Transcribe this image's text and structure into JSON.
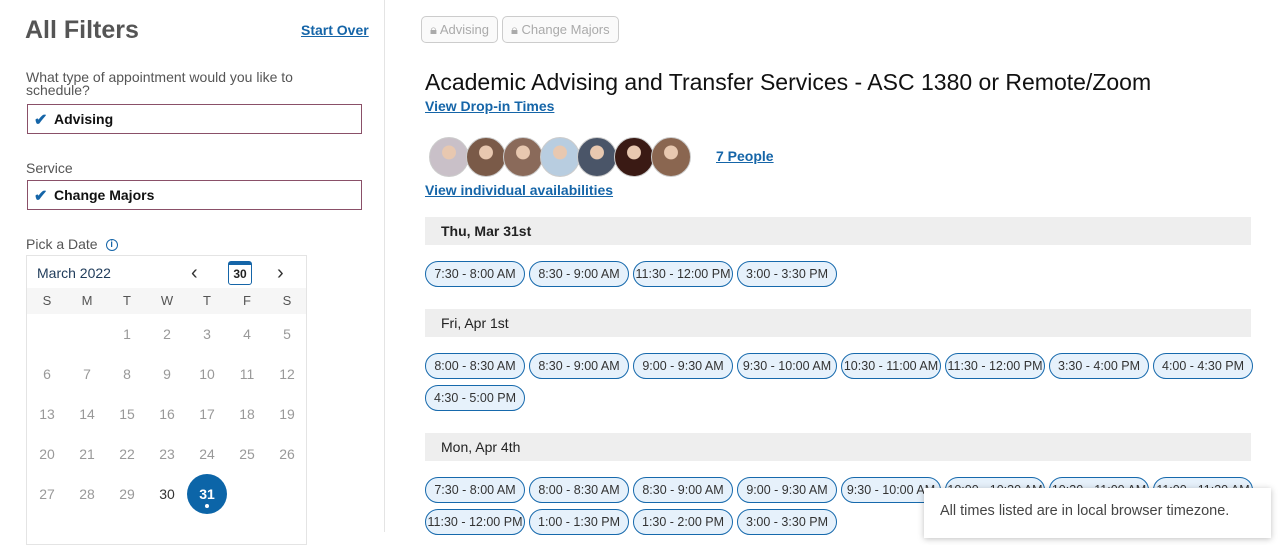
{
  "sidebar": {
    "title": "All Filters",
    "start_over": "Start Over",
    "appt_question": "What type of appointment would you like to schedule?",
    "appt_value": "Advising",
    "service_label": "Service",
    "service_value": "Change Majors",
    "date_label": "Pick a Date"
  },
  "calendar": {
    "month": "March 2022",
    "today": "30",
    "weekdays": [
      "S",
      "M",
      "T",
      "W",
      "T",
      "F",
      "S"
    ],
    "days": [
      "",
      "",
      "1",
      "2",
      "3",
      "4",
      "5",
      "6",
      "7",
      "8",
      "9",
      "10",
      "11",
      "12",
      "13",
      "14",
      "15",
      "16",
      "17",
      "18",
      "19",
      "20",
      "21",
      "22",
      "23",
      "24",
      "25",
      "26",
      "27",
      "28",
      "29",
      "30",
      "31",
      "",
      ""
    ],
    "available": [
      "30",
      "31"
    ],
    "selected": "31"
  },
  "chips": [
    "Advising",
    "Change Majors"
  ],
  "main": {
    "title": "Academic Advising and Transfer Services - ASC 1380 or Remote/Zoom",
    "drop_in": "View Drop-in Times",
    "people": "7 People",
    "individual": "View individual availabilities"
  },
  "avatar_colors": [
    "#c9c0c8",
    "#7a5a48",
    "#8a6a5a",
    "#b8cde0",
    "#4a5568",
    "#3a1a14",
    "#8a6650"
  ],
  "days": [
    {
      "label": "Thu, Mar 31st",
      "slots": [
        "7:30 - 8:00 AM",
        "8:30 - 9:00 AM",
        "11:30 - 12:00 PM",
        "3:00 - 3:30 PM"
      ]
    },
    {
      "label": "Fri, Apr 1st",
      "slots": [
        "8:00 - 8:30 AM",
        "8:30 - 9:00 AM",
        "9:00 - 9:30 AM",
        "9:30 - 10:00 AM",
        "10:30 - 11:00 AM",
        "11:30 - 12:00 PM",
        "3:30 - 4:00 PM",
        "4:00 - 4:30 PM",
        "4:30 - 5:00 PM"
      ]
    },
    {
      "label": "Mon, Apr 4th",
      "slots": [
        "7:30 - 8:00 AM",
        "8:00 - 8:30 AM",
        "8:30 - 9:00 AM",
        "9:00 - 9:30 AM",
        "9:30 - 10:00 AM",
        "10:00 - 10:30 AM",
        "10:30 - 11:00 AM",
        "11:00 - 11:30 AM",
        "11:30 - 12:00 PM",
        "1:00 - 1:30 PM",
        "1:30 - 2:00 PM",
        "3:00 - 3:30 PM"
      ]
    }
  ],
  "tooltip": "All times listed are in local browser timezone.",
  "colors": {
    "accent": "#1565a8",
    "slot_bg": "#e6f1fb"
  }
}
